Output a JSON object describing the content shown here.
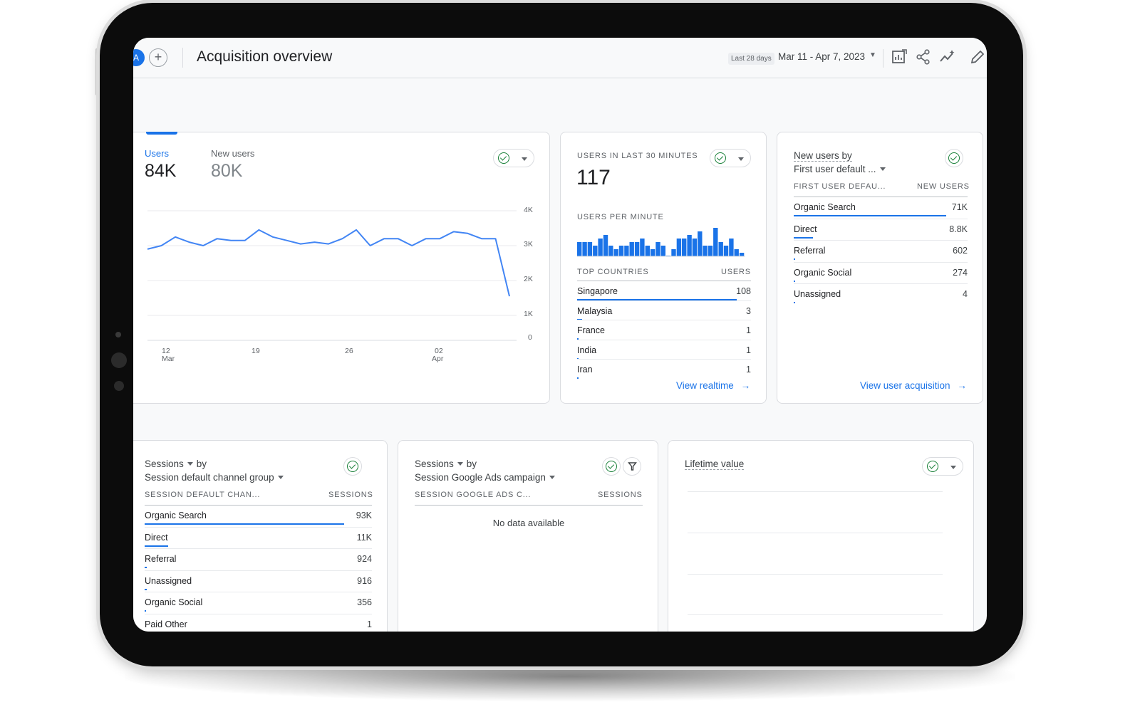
{
  "header": {
    "avatar_letter": "A",
    "add_symbol": "+",
    "title": "Acquisition overview",
    "date_badge": "Last 28 days",
    "date_range": "Mar 11 - Apr 7, 2023",
    "icons": [
      "customize-report-icon",
      "share-icon",
      "insights-icon",
      "edit-icon"
    ]
  },
  "users_card": {
    "metrics": [
      {
        "label": "Users",
        "value": "84K",
        "active": true
      },
      {
        "label": "New users",
        "value": "80K",
        "active": false
      }
    ],
    "y_ticks": [
      "4K",
      "3K",
      "2K",
      "1K",
      "0"
    ],
    "x_ticks": [
      {
        "day": "12",
        "month": "Mar"
      },
      {
        "day": "19",
        "month": ""
      },
      {
        "day": "26",
        "month": ""
      },
      {
        "day": "02",
        "month": "Apr"
      }
    ],
    "chart_data": {
      "type": "line",
      "series": [
        {
          "name": "Users",
          "values": [
            2.9,
            3.0,
            3.25,
            3.1,
            3.0,
            3.2,
            3.15,
            3.15,
            3.45,
            3.25,
            3.15,
            3.05,
            3.1,
            3.05,
            3.2,
            3.45,
            3.0,
            3.2,
            3.2,
            3.0,
            3.2,
            3.2,
            3.4,
            3.35,
            3.2,
            3.2,
            1.55
          ]
        }
      ],
      "ylim": [
        0,
        4
      ],
      "unit": "thousands",
      "color": "#4285f4"
    }
  },
  "realtime_card": {
    "title": "USERS IN LAST 30 MINUTES",
    "value": "117",
    "subtitle": "USERS PER MINUTE",
    "bar_data": {
      "type": "bar",
      "values": [
        4,
        4,
        4,
        3,
        5,
        6,
        3,
        2,
        3,
        3,
        4,
        4,
        5,
        3,
        2,
        4,
        3,
        0,
        2,
        5,
        5,
        6,
        5,
        7,
        3,
        3,
        8,
        4,
        3,
        5,
        2,
        1
      ],
      "color": "#1a73e8"
    },
    "table_header": {
      "dimension": "TOP COUNTRIES",
      "metric": "USERS"
    },
    "rows": [
      {
        "label": "Singapore",
        "value": "108",
        "fraction": 1.0
      },
      {
        "label": "Malaysia",
        "value": "3",
        "fraction": 0.03
      },
      {
        "label": "France",
        "value": "1",
        "fraction": 0.01
      },
      {
        "label": "India",
        "value": "1",
        "fraction": 0.01
      },
      {
        "label": "Iran",
        "value": "1",
        "fraction": 0.01
      }
    ],
    "link": "View realtime"
  },
  "new_users_card": {
    "title_line1": "New users by",
    "title_line2": "First user default ...",
    "table_header": {
      "dimension": "FIRST USER DEFAU...",
      "metric": "NEW USERS"
    },
    "rows": [
      {
        "label": "Organic Search",
        "value": "71K",
        "fraction": 1.0
      },
      {
        "label": "Direct",
        "value": "8.8K",
        "fraction": 0.124
      },
      {
        "label": "Referral",
        "value": "602",
        "fraction": 0.01
      },
      {
        "label": "Organic Social",
        "value": "274",
        "fraction": 0.005
      },
      {
        "label": "Unassigned",
        "value": "4",
        "fraction": 0.0
      }
    ],
    "link": "View user acquisition"
  },
  "sessions_channel_card": {
    "title_metric": "Sessions",
    "title_by": "by",
    "title_dimension": "Session default channel group",
    "table_header": {
      "dimension": "SESSION DEFAULT CHAN...",
      "metric": "SESSIONS"
    },
    "rows": [
      {
        "label": "Organic Search",
        "value": "93K",
        "fraction": 1.0
      },
      {
        "label": "Direct",
        "value": "11K",
        "fraction": 0.118
      },
      {
        "label": "Referral",
        "value": "924",
        "fraction": 0.01
      },
      {
        "label": "Unassigned",
        "value": "916",
        "fraction": 0.01
      },
      {
        "label": "Organic Social",
        "value": "356",
        "fraction": 0.004
      },
      {
        "label": "Paid Other",
        "value": "1",
        "fraction": 0.0
      }
    ]
  },
  "sessions_ads_card": {
    "title_metric": "Sessions",
    "title_by": "by",
    "title_dimension": "Session Google Ads campaign",
    "table_header": {
      "dimension": "SESSION GOOGLE ADS C...",
      "metric": "SESSIONS"
    },
    "empty_message": "No data available"
  },
  "lifetime_card": {
    "title": "Lifetime value"
  },
  "colors": {
    "accent": "#1a73e8",
    "check": "#188038",
    "line": "#4285f4"
  }
}
